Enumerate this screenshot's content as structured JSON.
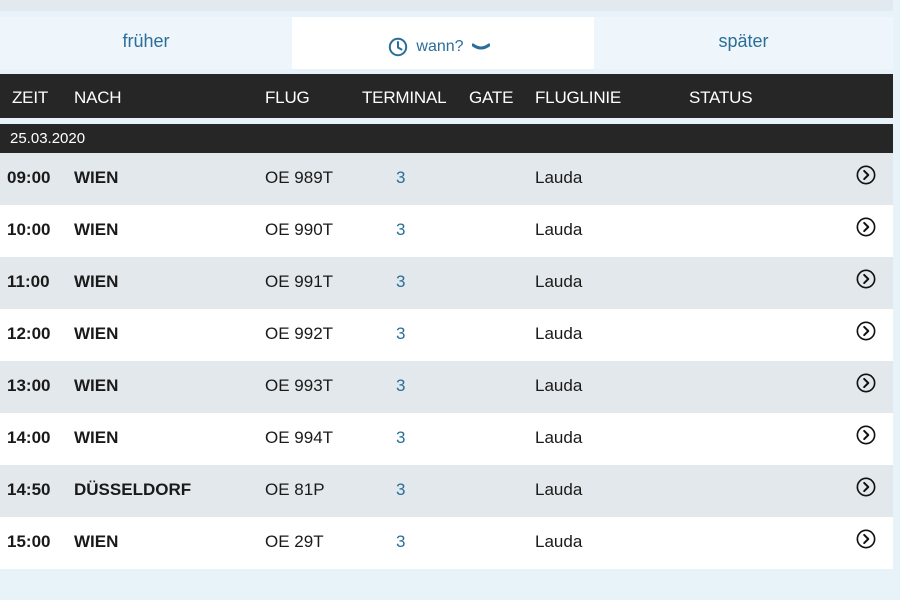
{
  "nav": {
    "earlier_label": "früher",
    "when_label": "wann?",
    "later_label": "später"
  },
  "table": {
    "columns": [
      "ZEIT",
      "NACH",
      "FLUG",
      "TERMINAL",
      "GATE",
      "FLUGLINIE",
      "STATUS"
    ],
    "date": "25.03.2020",
    "rows": [
      {
        "time": "09:00",
        "destination": "WIEN",
        "flight": "OE 989T",
        "terminal": "3",
        "airline": "Lauda"
      },
      {
        "time": "10:00",
        "destination": "WIEN",
        "flight": "OE 990T",
        "terminal": "3",
        "airline": "Lauda"
      },
      {
        "time": "11:00",
        "destination": "WIEN",
        "flight": "OE 991T",
        "terminal": "3",
        "airline": "Lauda"
      },
      {
        "time": "12:00",
        "destination": "WIEN",
        "flight": "OE 992T",
        "terminal": "3",
        "airline": "Lauda"
      },
      {
        "time": "13:00",
        "destination": "WIEN",
        "flight": "OE 993T",
        "terminal": "3",
        "airline": "Lauda"
      },
      {
        "time": "14:00",
        "destination": "WIEN",
        "flight": "OE 994T",
        "terminal": "3",
        "airline": "Lauda"
      },
      {
        "time": "14:50",
        "destination": "DÜSSELDORF",
        "flight": "OE 81P",
        "terminal": "3",
        "airline": "Lauda"
      },
      {
        "time": "15:00",
        "destination": "WIEN",
        "flight": "OE 29T",
        "terminal": "3",
        "airline": "Lauda"
      }
    ]
  },
  "icons": {
    "when": "clock-icon",
    "when_toggle": "chevron-down-icon",
    "row_detail": "chevron-right-circle-icon"
  },
  "colors": {
    "accent": "#2b6e9a",
    "header_bg": "#262626",
    "row_alt_bg": "#e2e8ec",
    "row_bg": "#ffffff"
  }
}
